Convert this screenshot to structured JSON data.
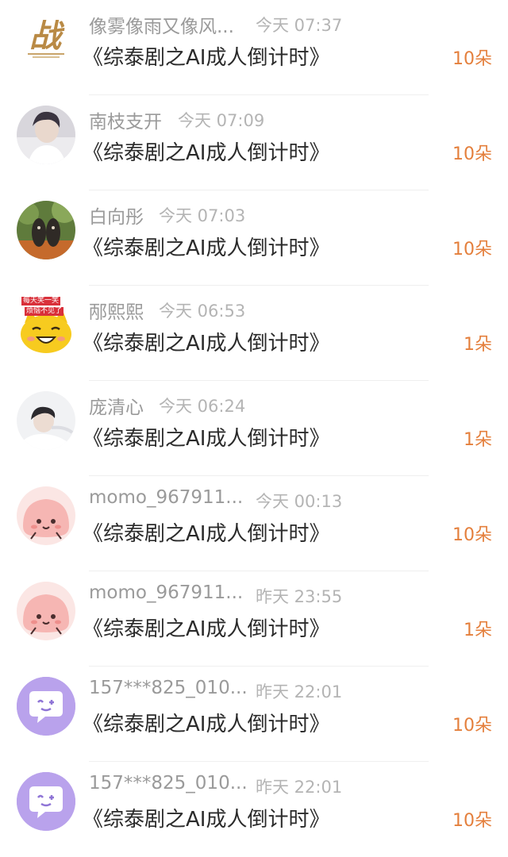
{
  "gifts": [
    {
      "name": "像雾像雨又像风...",
      "time": "今天 07:37",
      "title": "《综泰剧之AI成人倒计时》",
      "count": "10朵",
      "avatar": "zhan-logo-avatar"
    },
    {
      "name": "南枝支开",
      "time": "今天 07:09",
      "title": "《综泰剧之AI成人倒计时》",
      "count": "10朵",
      "avatar": "user-photo-avatar"
    },
    {
      "name": "白向彤",
      "time": "今天 07:03",
      "title": "《综泰剧之AI成人倒计时》",
      "count": "10朵",
      "avatar": "user-photo-avatar"
    },
    {
      "name": "邴熙熙",
      "time": "今天 06:53",
      "title": "《综泰剧之AI成人倒计时》",
      "count": "1朵",
      "avatar": "cartoon-cat-avatar",
      "avatar_text": [
        "每天笑一笑",
        "烦恼不见了"
      ]
    },
    {
      "name": "庞清心",
      "time": "今天 06:24",
      "title": "《综泰剧之AI成人倒计时》",
      "count": "1朵",
      "avatar": "user-photo-avatar"
    },
    {
      "name": "momo_967911...",
      "time": "今天 00:13",
      "title": "《综泰剧之AI成人倒计时》",
      "count": "10朵",
      "avatar": "pink-blob-avatar"
    },
    {
      "name": "momo_967911...",
      "time": "昨天 23:55",
      "title": "《综泰剧之AI成人倒计时》",
      "count": "1朵",
      "avatar": "pink-blob-avatar"
    },
    {
      "name": "157***825_010...",
      "time": "昨天 22:01",
      "title": "《综泰剧之AI成人倒计时》",
      "count": "10朵",
      "avatar": "purple-chat-avatar"
    },
    {
      "name": "157***825_010...",
      "time": "昨天 22:01",
      "title": "《综泰剧之AI成人倒计时》",
      "count": "10朵",
      "avatar": "purple-chat-avatar"
    }
  ],
  "colors": {
    "count": "#e47f3c",
    "name": "#9a9a9a",
    "time": "#b4b4b4",
    "title": "#2b2b2b"
  }
}
